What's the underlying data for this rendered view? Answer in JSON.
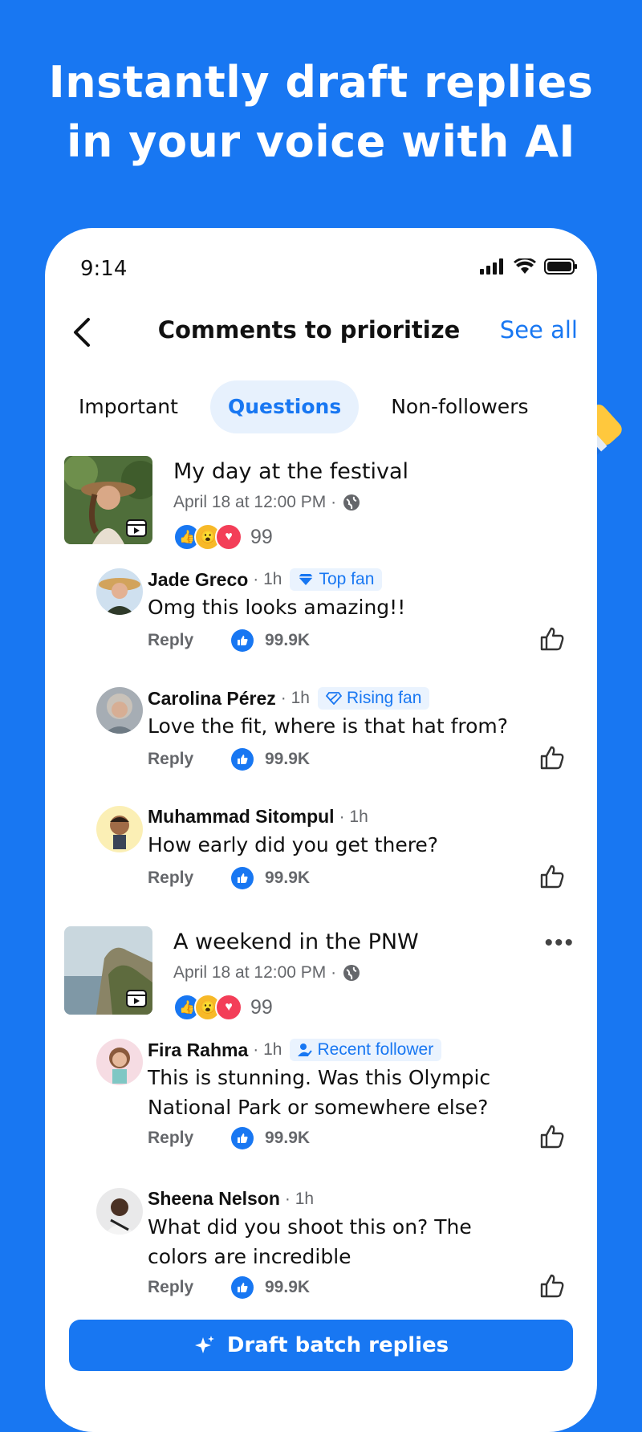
{
  "headline": {
    "line1": "Instantly draft replies",
    "line2": "in your voice with AI"
  },
  "status": {
    "time": "9:14"
  },
  "nav": {
    "title": "Comments to prioritize",
    "see_all": "See all"
  },
  "tabs": [
    {
      "label": "Important",
      "active": false
    },
    {
      "label": "Questions",
      "active": true
    },
    {
      "label": "Non-followers",
      "active": false
    }
  ],
  "posts": [
    {
      "title": "My day at the festival",
      "meta": "April 18 at 12:00 PM ·",
      "reaction_count": "99",
      "comments": [
        {
          "name": "Jade Greco",
          "time": "· 1h",
          "badge": "Top fan",
          "badge_icon": "diamond-icon",
          "text": "Omg this looks amazing!!",
          "reply": "Reply",
          "likes": "99.9K"
        },
        {
          "name": "Carolina Pérez",
          "time": "· 1h",
          "badge": "Rising fan",
          "badge_icon": "rising-diamond-icon",
          "text": "Love the fit, where is that hat from?",
          "reply": "Reply",
          "likes": "99.9K"
        },
        {
          "name": "Muhammad Sitompul",
          "time": "· 1h",
          "badge": "",
          "text": "How early did you get there?",
          "reply": "Reply",
          "likes": "99.9K"
        }
      ]
    },
    {
      "title": "A weekend in the PNW",
      "meta": "April 18 at 12:00 PM ·",
      "reaction_count": "99",
      "comments": [
        {
          "name": "Fira Rahma",
          "time": "· 1h",
          "badge": "Recent follower",
          "badge_icon": "person-check-icon",
          "text": "This is stunning. Was this Olympic National Park or somewhere else?",
          "reply": "Reply",
          "likes": "99.9K"
        },
        {
          "name": "Sheena Nelson",
          "time": "· 1h",
          "badge": "",
          "text": "What did you shoot this on? The colors are incredible",
          "reply": "Reply",
          "likes": "99.9K"
        }
      ]
    }
  ],
  "draft_button": {
    "label": "Draft batch replies"
  },
  "colors": {
    "brand": "#1877F2",
    "badge_bg": "#EAF3FE",
    "tab_active_bg": "#E7F1FD"
  }
}
